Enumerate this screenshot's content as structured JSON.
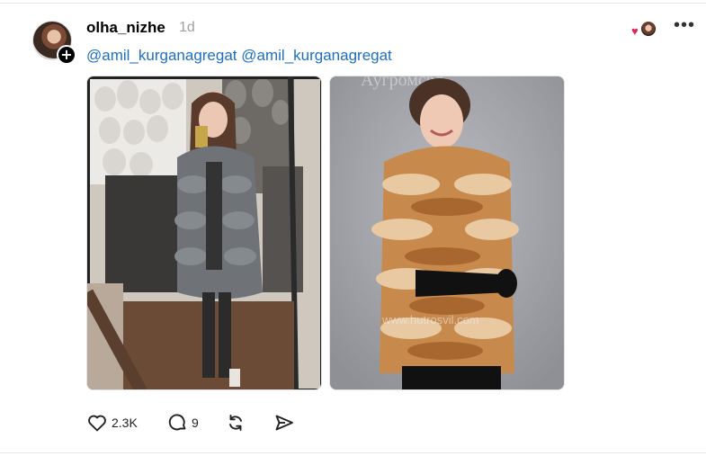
{
  "post": {
    "author": "olha_nizhe",
    "time": "1d",
    "follow_symbol": "+",
    "caption_mentions": [
      "@amil_kurganagregat",
      "@amil_kurganagregat"
    ],
    "images": [
      {
        "watermark": ""
      },
      {
        "watermark_top": "Аугромсвл",
        "watermark_bottom": "www.hutrosvil.com"
      }
    ],
    "actions": {
      "like_count": "2.3K",
      "reply_count": "9"
    },
    "more_symbol": "•••",
    "like_heart": "♥"
  },
  "colors": {
    "mention": "#1d6fc0",
    "muted": "#a0a0a0",
    "heart": "#e0245e"
  }
}
